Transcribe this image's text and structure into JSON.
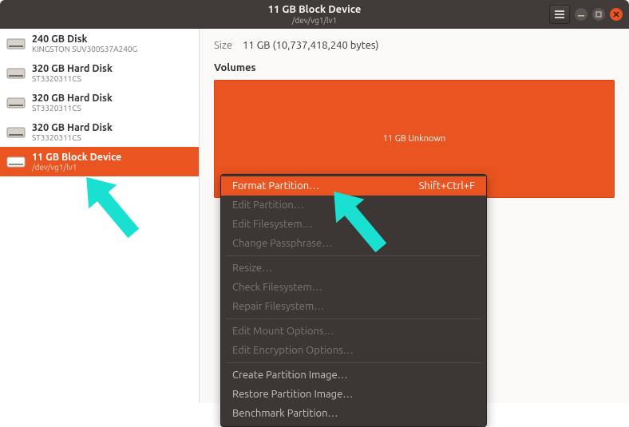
{
  "header": {
    "title": "11 GB Block Device",
    "subtitle": "/dev/vg1/lv1"
  },
  "sidebar": {
    "items": [
      {
        "name": "240 GB Disk",
        "sub": "KINGSTON SUV300S37A240G"
      },
      {
        "name": "320 GB Hard Disk",
        "sub": "ST3320311CS"
      },
      {
        "name": "320 GB Hard Disk",
        "sub": "ST3320311CS"
      },
      {
        "name": "320 GB Hard Disk",
        "sub": "ST3320311CS"
      },
      {
        "name": "11 GB Block Device",
        "sub": "/dev/vg1/lv1"
      }
    ],
    "selected_index": 4
  },
  "main": {
    "size_label": "Size",
    "size_value": "11 GB (10,737,418,240 bytes)",
    "volumes_heading": "Volumes",
    "volume_label": "11 GB Unknown"
  },
  "menu": {
    "items": [
      {
        "label": "Format Partition…",
        "shortcut": "Shift+Ctrl+F",
        "highlighted": true,
        "enabled": true
      },
      {
        "label": "Edit Partition…",
        "enabled": false
      },
      {
        "label": "Edit Filesystem…",
        "enabled": false
      },
      {
        "label": "Change Passphrase…",
        "enabled": false
      },
      {
        "sep": true
      },
      {
        "label": "Resize…",
        "enabled": false
      },
      {
        "label": "Check Filesystem…",
        "enabled": false
      },
      {
        "label": "Repair Filesystem…",
        "enabled": false
      },
      {
        "sep": true
      },
      {
        "label": "Edit Mount Options…",
        "enabled": false
      },
      {
        "label": "Edit Encryption Options…",
        "enabled": false
      },
      {
        "sep": true
      },
      {
        "label": "Create Partition Image…",
        "enabled": true
      },
      {
        "label": "Restore Partition Image…",
        "enabled": true
      },
      {
        "label": "Benchmark Partition…",
        "enabled": true
      }
    ]
  },
  "colors": {
    "accent": "#e95420",
    "arrow": "#19e0d0"
  }
}
